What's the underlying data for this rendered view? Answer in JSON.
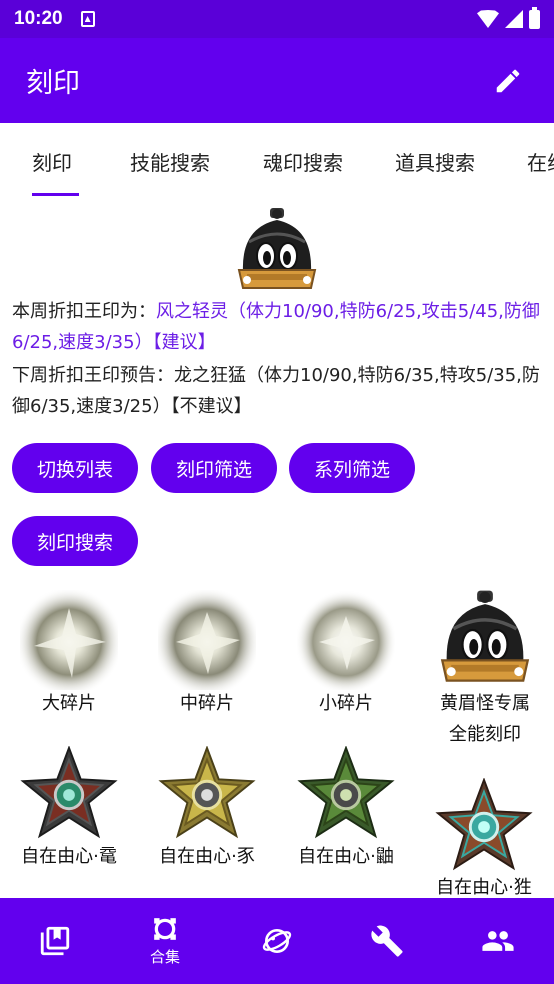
{
  "status_bar": {
    "time": "10:20"
  },
  "app_bar": {
    "title": "刻印"
  },
  "tabs": [
    {
      "label": "刻印",
      "selected": true
    },
    {
      "label": "技能搜索"
    },
    {
      "label": "魂印搜索"
    },
    {
      "label": "道具搜索"
    },
    {
      "label": "在线"
    }
  ],
  "info": {
    "this_week_prefix": "本周折扣王印为：",
    "this_week_value": "风之轻灵（体力10/90,特防6/25,攻击5/45,防御6/25,速度3/35）【建议】",
    "next_week": "下周折扣王印预告：龙之狂猛（体力10/90,特防6/35,特攻5/35,防御6/35,速度3/25）【不建议】"
  },
  "buttons": {
    "switch_list": "切换列表",
    "mark_filter": "刻印筛选",
    "series_filter": "系列筛选",
    "mark_search": "刻印搜索"
  },
  "items": [
    {
      "name": "大碎片",
      "icon": "shard-icon"
    },
    {
      "name": "中碎片",
      "icon": "shard-icon"
    },
    {
      "name": "小碎片",
      "icon": "shard-icon"
    },
    {
      "name": "黄眉怪专属\n全能刻印",
      "icon": "bomb-mascot-icon"
    },
    {
      "name": "自在由心·鼋",
      "icon": "star-medal-icon",
      "color": "#2a8a6a"
    },
    {
      "name": "自在由心·豕",
      "icon": "star-medal-icon",
      "color": "#c9b64a"
    },
    {
      "name": "自在由心·鼬",
      "icon": "star-medal-icon",
      "color": "#5a8a3a"
    },
    {
      "name": "自在由心·狌",
      "icon": "star-medal-icon",
      "color": "#3aa8a0"
    }
  ],
  "bottom_nav": [
    {
      "icon": "bookmark-library-icon",
      "label": ""
    },
    {
      "icon": "collection-icon",
      "label": "合集"
    },
    {
      "icon": "planet-icon",
      "label": ""
    },
    {
      "icon": "wrench-icon",
      "label": ""
    },
    {
      "icon": "people-icon",
      "label": ""
    }
  ],
  "colors": {
    "primary": "#6200ee",
    "status_bar": "#5a00d8",
    "highlight_text": "#6c1ee6"
  }
}
